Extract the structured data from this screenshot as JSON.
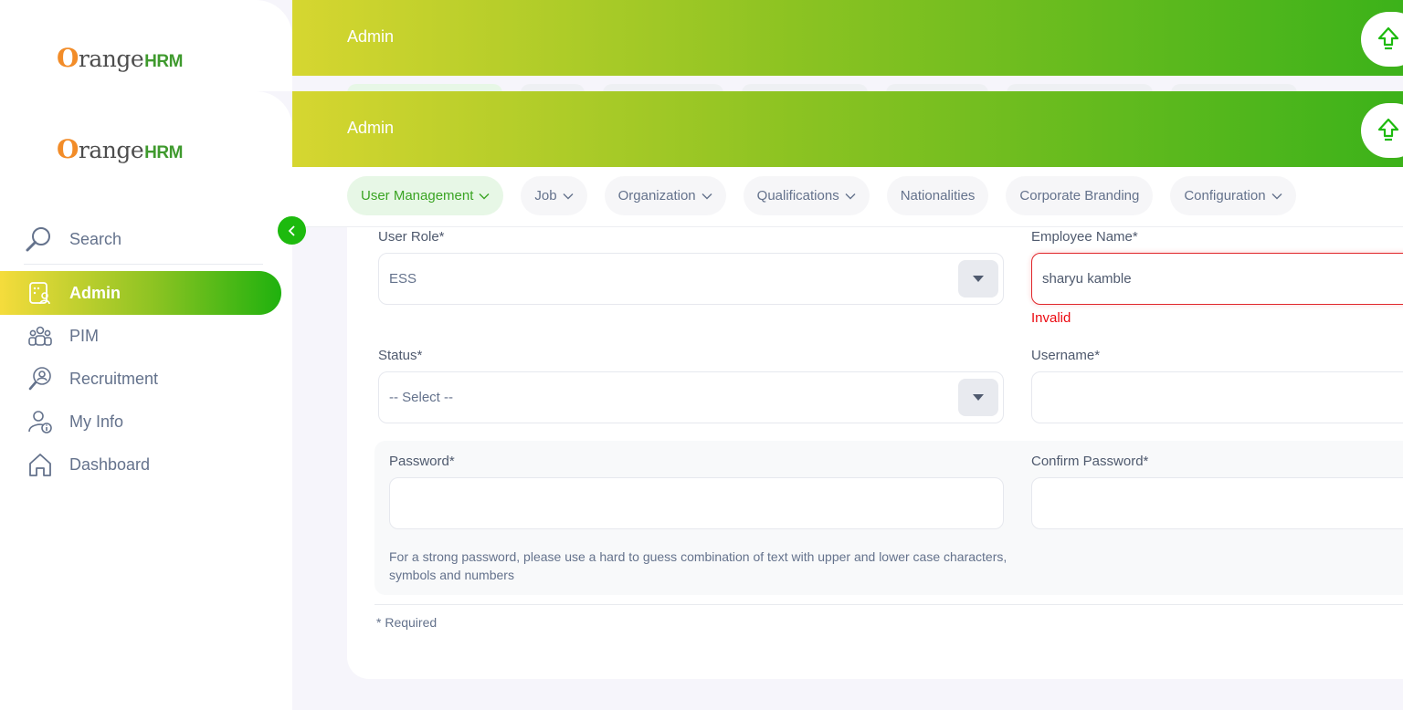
{
  "brand": {
    "o": "O",
    "range": "range",
    "hrm": "HRM"
  },
  "header": {
    "title": "Admin"
  },
  "sidebar": {
    "search_label": "Search",
    "items": [
      {
        "label": "Admin",
        "icon": "admin-icon",
        "active": true
      },
      {
        "label": "PIM",
        "icon": "pim-icon"
      },
      {
        "label": "Recruitment",
        "icon": "recruitment-icon"
      },
      {
        "label": "My Info",
        "icon": "my-info-icon"
      },
      {
        "label": "Dashboard",
        "icon": "dashboard-icon"
      }
    ]
  },
  "tabs": [
    {
      "label": "User Management",
      "has_dropdown": true,
      "active": true
    },
    {
      "label": "Job",
      "has_dropdown": true
    },
    {
      "label": "Organization",
      "has_dropdown": true
    },
    {
      "label": "Qualifications",
      "has_dropdown": true
    },
    {
      "label": "Nationalities",
      "has_dropdown": false
    },
    {
      "label": "Corporate Branding",
      "has_dropdown": false
    },
    {
      "label": "Configuration",
      "has_dropdown": true
    }
  ],
  "form": {
    "user_role": {
      "label": "User Role*",
      "value": "ESS"
    },
    "employee_name": {
      "label": "Employee Name*",
      "value": "sharyu kamble",
      "error": "Invalid"
    },
    "status": {
      "label": "Status*",
      "value": "-- Select --"
    },
    "username": {
      "label": "Username*",
      "value": ""
    },
    "password": {
      "label": "Password*",
      "value": ""
    },
    "confirm_password": {
      "label": "Confirm Password*",
      "value": ""
    },
    "password_hint": "For a strong password, please use a hard to guess combination of text with upper and lower case characters, symbols and numbers",
    "required_note": "* Required"
  },
  "colors": {
    "accent": "#1dba0e",
    "tab_active_bg": "#e7f7e6",
    "error": "#eb0910",
    "header_start": "#d6d630",
    "header_end": "#3cb21a"
  }
}
